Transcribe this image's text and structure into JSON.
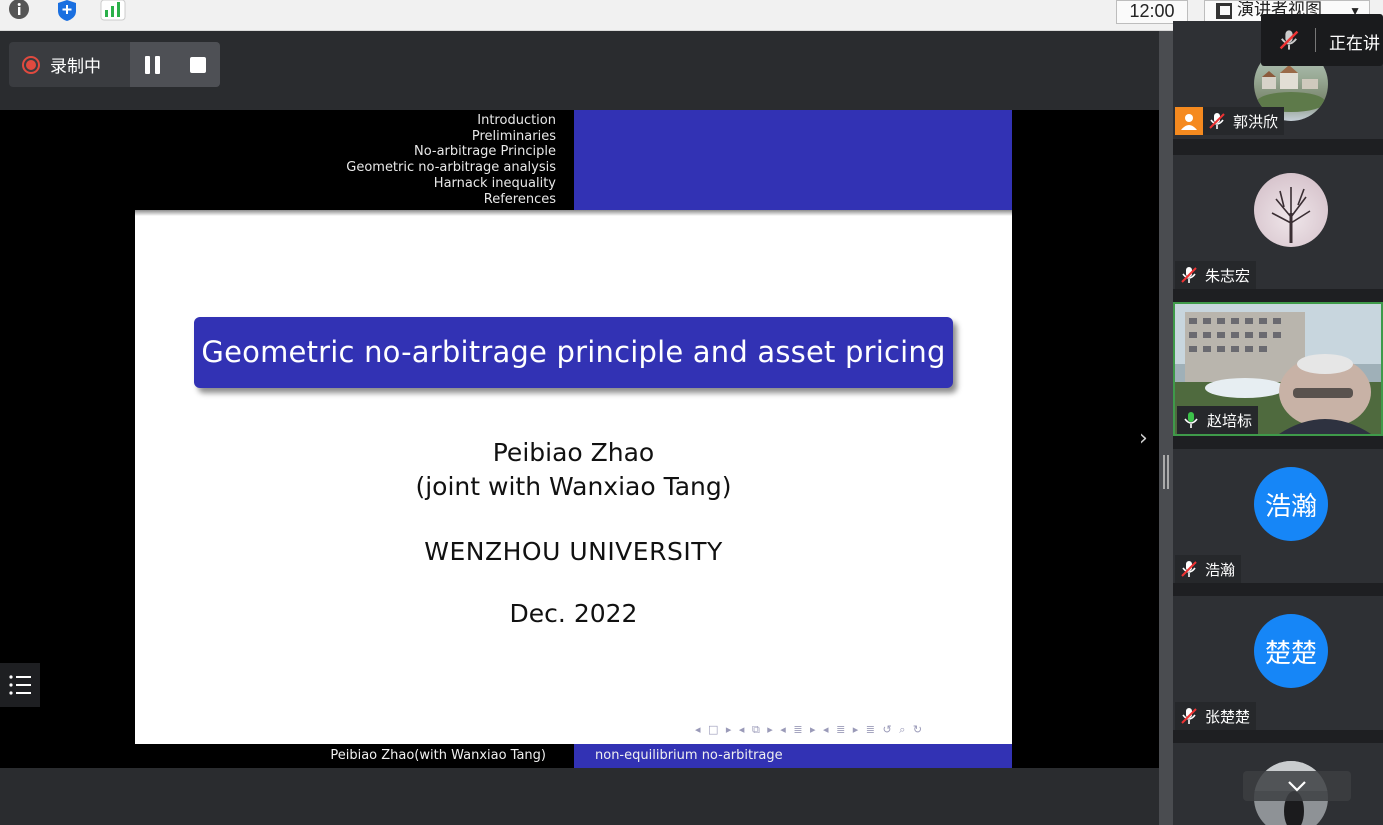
{
  "topbar": {
    "clock": "12:00",
    "presenter_view_label": "演讲者视图"
  },
  "recording": {
    "status_label": "录制中"
  },
  "slide": {
    "nav_sections": [
      "Introduction",
      "Preliminaries",
      "No-arbitrage Principle",
      "Geometric no-arbitrage analysis",
      "Harnack inequality",
      "References"
    ],
    "title": "Geometric no-arbitrage principle and asset pricing",
    "author_line1": "Peibiao Zhao",
    "author_line2": "(joint with Wanxiao Tang)",
    "institution": "WENZHOU UNIVERSITY",
    "date": "Dec. 2022",
    "footer_left": "Peibiao Zhao(with Wanxiao Tang)",
    "footer_right": "non-equilibrium no-arbitrage"
  },
  "participants": [
    {
      "name": "郭洪欣",
      "avatar": "photo-village",
      "role": "host",
      "mic": "muted"
    },
    {
      "name": "朱志宏",
      "avatar": "photo-tree",
      "mic": "muted"
    },
    {
      "name": "赵培标",
      "avatar": "video",
      "mic": "active"
    },
    {
      "name": "浩瀚",
      "avatar_text": "浩瀚",
      "mic": "muted"
    },
    {
      "name": "张楚楚",
      "avatar_text": "楚楚",
      "mic": "muted"
    }
  ],
  "speaking_indicator": "正在讲",
  "colors": {
    "slide_blue": "#3232b4",
    "avatar_blue": "#1686f7",
    "rec_red": "#e04a3f",
    "active_border": "#3f9a4a",
    "host_orange": "#f58a1f"
  }
}
